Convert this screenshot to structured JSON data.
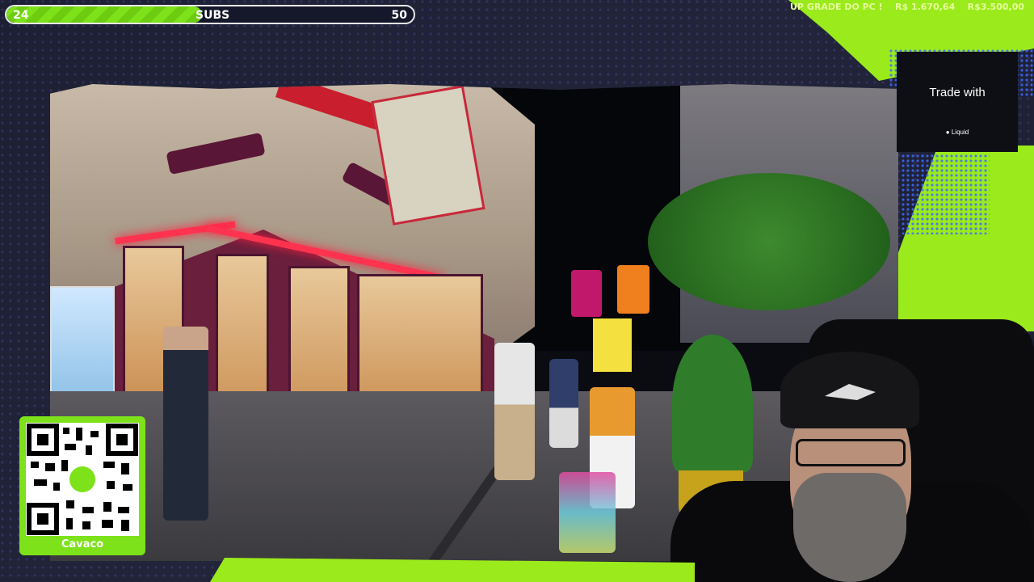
{
  "subs_goal": {
    "current": "24",
    "label": "SUBS",
    "target": "50",
    "progress": 0.48
  },
  "upgrade": {
    "label": "UP GRADE DO PC !",
    "current": "R$ 1.670,64",
    "goal": "R$3.500,00"
  },
  "sponsor": {
    "title": "Trade with",
    "brand": "Liquid"
  },
  "qr": {
    "label": "Cavaco"
  },
  "colors": {
    "accent_green": "#9bea1c",
    "background": "#1a1d2e",
    "blue_pattern": "#3a6bff"
  }
}
